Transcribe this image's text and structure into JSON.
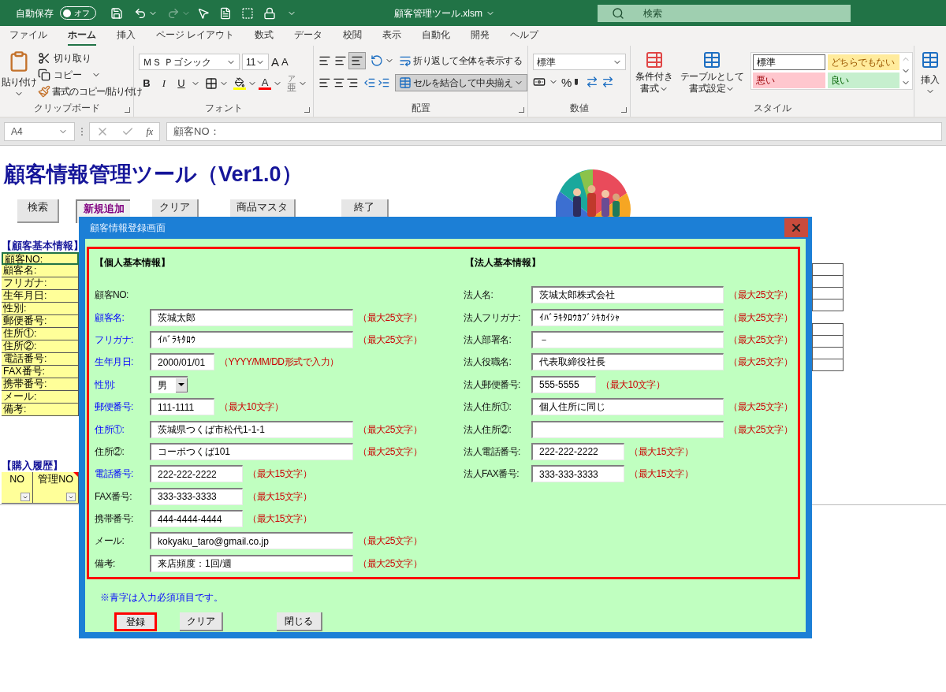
{
  "title_bar": {
    "autosave_label": "自動保存",
    "autosave": {
      "label": "オフ",
      "on": false
    },
    "filename": "顧客管理ツール.xlsm",
    "search_placeholder": "検索"
  },
  "ribbon_tabs": [
    {
      "label": "ファイル",
      "selected": false
    },
    {
      "label": "ホーム",
      "selected": true
    },
    {
      "label": "挿入",
      "selected": false
    },
    {
      "label": "ページ レイアウト",
      "selected": false
    },
    {
      "label": "数式",
      "selected": false
    },
    {
      "label": "データ",
      "selected": false
    },
    {
      "label": "校閲",
      "selected": false
    },
    {
      "label": "表示",
      "selected": false
    },
    {
      "label": "自動化",
      "selected": false
    },
    {
      "label": "開発",
      "selected": false
    },
    {
      "label": "ヘルプ",
      "selected": false
    }
  ],
  "ribbon": {
    "clipboard": {
      "paste": "貼り付け",
      "cut": "切り取り",
      "copy": "コピー",
      "format_painter": "書式のコピー/貼り付け",
      "label": "クリップボード"
    },
    "font": {
      "font_name": "ＭＳ Ｐゴシック",
      "font_size": "11",
      "grow": "A",
      "shrink": "A",
      "bold": "B",
      "italic": "I",
      "underline": "U",
      "font_color": "A",
      "phonetic_top": "ア",
      "phonetic_bottom": "亜",
      "label": "フォント"
    },
    "alignment": {
      "wrap_text": "折り返して全体を表示する",
      "merge_center": "セルを結合して中央揃え",
      "label": "配置"
    },
    "number": {
      "format": "標準",
      "percent": "%",
      "label": "数値"
    },
    "styles": {
      "conditional": [
        "条件付き",
        "書式"
      ],
      "as_table": [
        "テーブルとして",
        "書式設定"
      ],
      "label": "スタイル",
      "cell_styles": [
        {
          "label": "標準",
          "kind": "normal"
        },
        {
          "label": "どちらでもない",
          "kind": "neutral"
        },
        {
          "label": "悪い",
          "kind": "bad"
        },
        {
          "label": "良い",
          "kind": "good"
        }
      ]
    },
    "cells": {
      "insert": "挿入"
    }
  },
  "formula_bar": {
    "cell_ref": "A4",
    "fx": "fx",
    "value": "顧客NO："
  },
  "sheet": {
    "title": "顧客情報管理ツール（Ver1.0）",
    "buttons": [
      {
        "label": "検索",
        "selected": false
      },
      {
        "label": "新規追加",
        "selected": true
      },
      {
        "label": "クリア",
        "selected": false
      },
      {
        "label": "商品マスタ",
        "selected": false
      },
      {
        "label": "終了",
        "selected": false
      }
    ],
    "customer_section": {
      "heading": "【顧客基本情報】",
      "labels": [
        {
          "label": "顧客NO:",
          "selected": true
        },
        {
          "label": "顧客名:",
          "selected": false
        },
        {
          "label": "フリガナ:",
          "selected": false
        },
        {
          "label": "生年月日:",
          "selected": false
        },
        {
          "label": "性別:",
          "selected": false
        },
        {
          "label": "郵便番号:",
          "selected": false
        },
        {
          "label": "住所①:",
          "selected": false
        },
        {
          "label": "住所②:",
          "selected": false
        },
        {
          "label": "電話番号:",
          "selected": false
        },
        {
          "label": "FAX番号:",
          "selected": false
        },
        {
          "label": "携帯番号:",
          "selected": false
        },
        {
          "label": "メール:",
          "selected": false
        },
        {
          "label": "備考:",
          "selected": false
        }
      ]
    },
    "history_section": {
      "heading": "【購入履歴】",
      "columns": [
        "NO",
        "管理NO"
      ]
    }
  },
  "dialog": {
    "title": "顧客情報登録画面",
    "personal": {
      "heading": "【個人基本情報】",
      "fields": [
        {
          "label": "顧客NO:",
          "required": false,
          "kind": "static"
        },
        {
          "label": "顧客名:",
          "required": true,
          "kind": "long",
          "value": "茨城太郎",
          "hint": "（最大25文字）"
        },
        {
          "label": "フリガナ:",
          "required": true,
          "kind": "long",
          "value": "ｲﾊﾞﾗｷﾀﾛｳ",
          "hint": "（最大25文字）"
        },
        {
          "label": "生年月日:",
          "required": true,
          "kind": "short",
          "value": "2000/01/01",
          "hint": "（YYYY/MM/DD形式で入力）"
        },
        {
          "label": "性別:",
          "required": true,
          "kind": "combo",
          "value": "男"
        },
        {
          "label": "郵便番号:",
          "required": true,
          "kind": "short",
          "value": "111-1111",
          "hint": "（最大10文字）"
        },
        {
          "label": "住所①:",
          "required": true,
          "kind": "long",
          "value": "茨城県つくば市松代1-1-1",
          "hint": "（最大25文字）"
        },
        {
          "label": "住所②:",
          "required": false,
          "kind": "long",
          "value": "コーポつくば101",
          "hint": "（最大25文字）"
        },
        {
          "label": "電話番号:",
          "required": true,
          "kind": "medium",
          "value": "222-222-2222",
          "hint": "（最大15文字）"
        },
        {
          "label": "FAX番号:",
          "required": false,
          "kind": "medium",
          "value": "333-333-3333",
          "hint": "（最大15文字）"
        },
        {
          "label": "携帯番号:",
          "required": false,
          "kind": "medium",
          "value": "444-4444-4444",
          "hint": "（最大15文字）"
        },
        {
          "label": "メール:",
          "required": false,
          "kind": "long",
          "value": "kokyaku_taro@gmail.co.jp",
          "hint": "（最大25文字）"
        },
        {
          "label": "備考:",
          "required": false,
          "kind": "long",
          "value": "来店頻度：1回/週",
          "hint": "（最大25文字）"
        }
      ]
    },
    "corporate": {
      "heading": "【法人基本情報】",
      "fields": [
        {
          "label": "法人名:",
          "required": false,
          "kind": "long",
          "value": "茨城太郎株式会社",
          "hint": "（最大25文字）"
        },
        {
          "label": "法人フリガナ:",
          "required": false,
          "kind": "long",
          "value": "ｲﾊﾞﾗｷﾀﾛｳｶﾌﾞｼｷｶｲｼｬ",
          "hint": "（最大25文字）"
        },
        {
          "label": "法人部署名:",
          "required": false,
          "kind": "long",
          "value": "－",
          "hint": "（最大25文字）"
        },
        {
          "label": "法人役職名:",
          "required": false,
          "kind": "long",
          "value": "代表取締役社長",
          "hint": "（最大25文字）"
        },
        {
          "label": "法人郵便番号:",
          "required": false,
          "kind": "short",
          "value": "555-5555",
          "hint": "（最大10文字）"
        },
        {
          "label": "法人住所①:",
          "required": false,
          "kind": "long",
          "value": "個人住所に同じ",
          "hint": "（最大25文字）"
        },
        {
          "label": "法人住所②:",
          "required": false,
          "kind": "long",
          "hint": "（最大25文字）"
        },
        {
          "label": "法人電話番号:",
          "required": false,
          "kind": "medium",
          "value": "222-222-2222",
          "hint": "（最大15文字）"
        },
        {
          "label": "法人FAX番号:",
          "required": false,
          "kind": "medium",
          "value": "333-333-3333",
          "hint": "（最大15文字）"
        }
      ]
    },
    "note": "※青字は入力必須項目です。",
    "buttons": [
      {
        "label": "登録",
        "selected": true
      },
      {
        "label": "クリア",
        "selected": false
      },
      {
        "label": "閉じる",
        "selected": false
      }
    ]
  }
}
